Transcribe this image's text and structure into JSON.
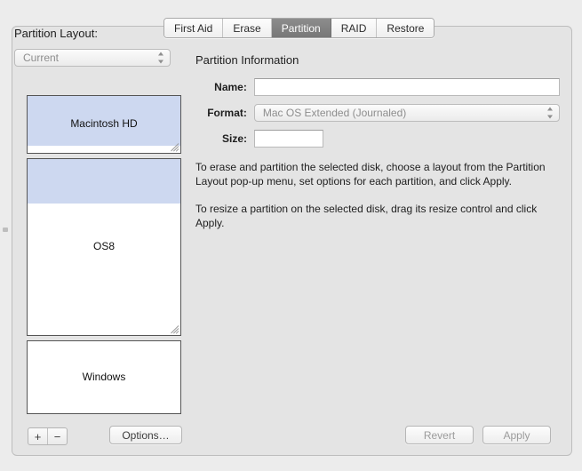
{
  "tabs": [
    {
      "label": "First Aid",
      "selected": false
    },
    {
      "label": "Erase",
      "selected": false
    },
    {
      "label": "Partition",
      "selected": true
    },
    {
      "label": "RAID",
      "selected": false
    },
    {
      "label": "Restore",
      "selected": false
    }
  ],
  "left": {
    "layout_label": "Partition Layout:",
    "layout_popup_value": "Current",
    "partitions": [
      {
        "name": "Macintosh HD",
        "used_percent": 88,
        "resizable": true
      },
      {
        "name": "OS8",
        "used_percent": 25,
        "resizable": true
      },
      {
        "name": "Windows",
        "used_percent": 0,
        "resizable": false
      }
    ],
    "add_label": "+",
    "remove_label": "−",
    "options_label": "Options…"
  },
  "right": {
    "title": "Partition Information",
    "name_label": "Name:",
    "name_value": "",
    "format_label": "Format:",
    "format_value": "Mac OS Extended (Journaled)",
    "size_label": "Size:",
    "size_value": "",
    "help_paragraph_1": "To erase and partition the selected disk, choose a layout from the Partition Layout pop-up menu, set options for each partition, and click Apply.",
    "help_paragraph_2": "To resize a partition on the selected disk, drag its resize control and click Apply."
  },
  "footer": {
    "revert_label": "Revert",
    "apply_label": "Apply"
  },
  "colors": {
    "window_background": "#ececec",
    "panel_background": "#e4e4e4",
    "partition_used_fill": "#cdd8f0",
    "selected_tab": "#808080"
  }
}
